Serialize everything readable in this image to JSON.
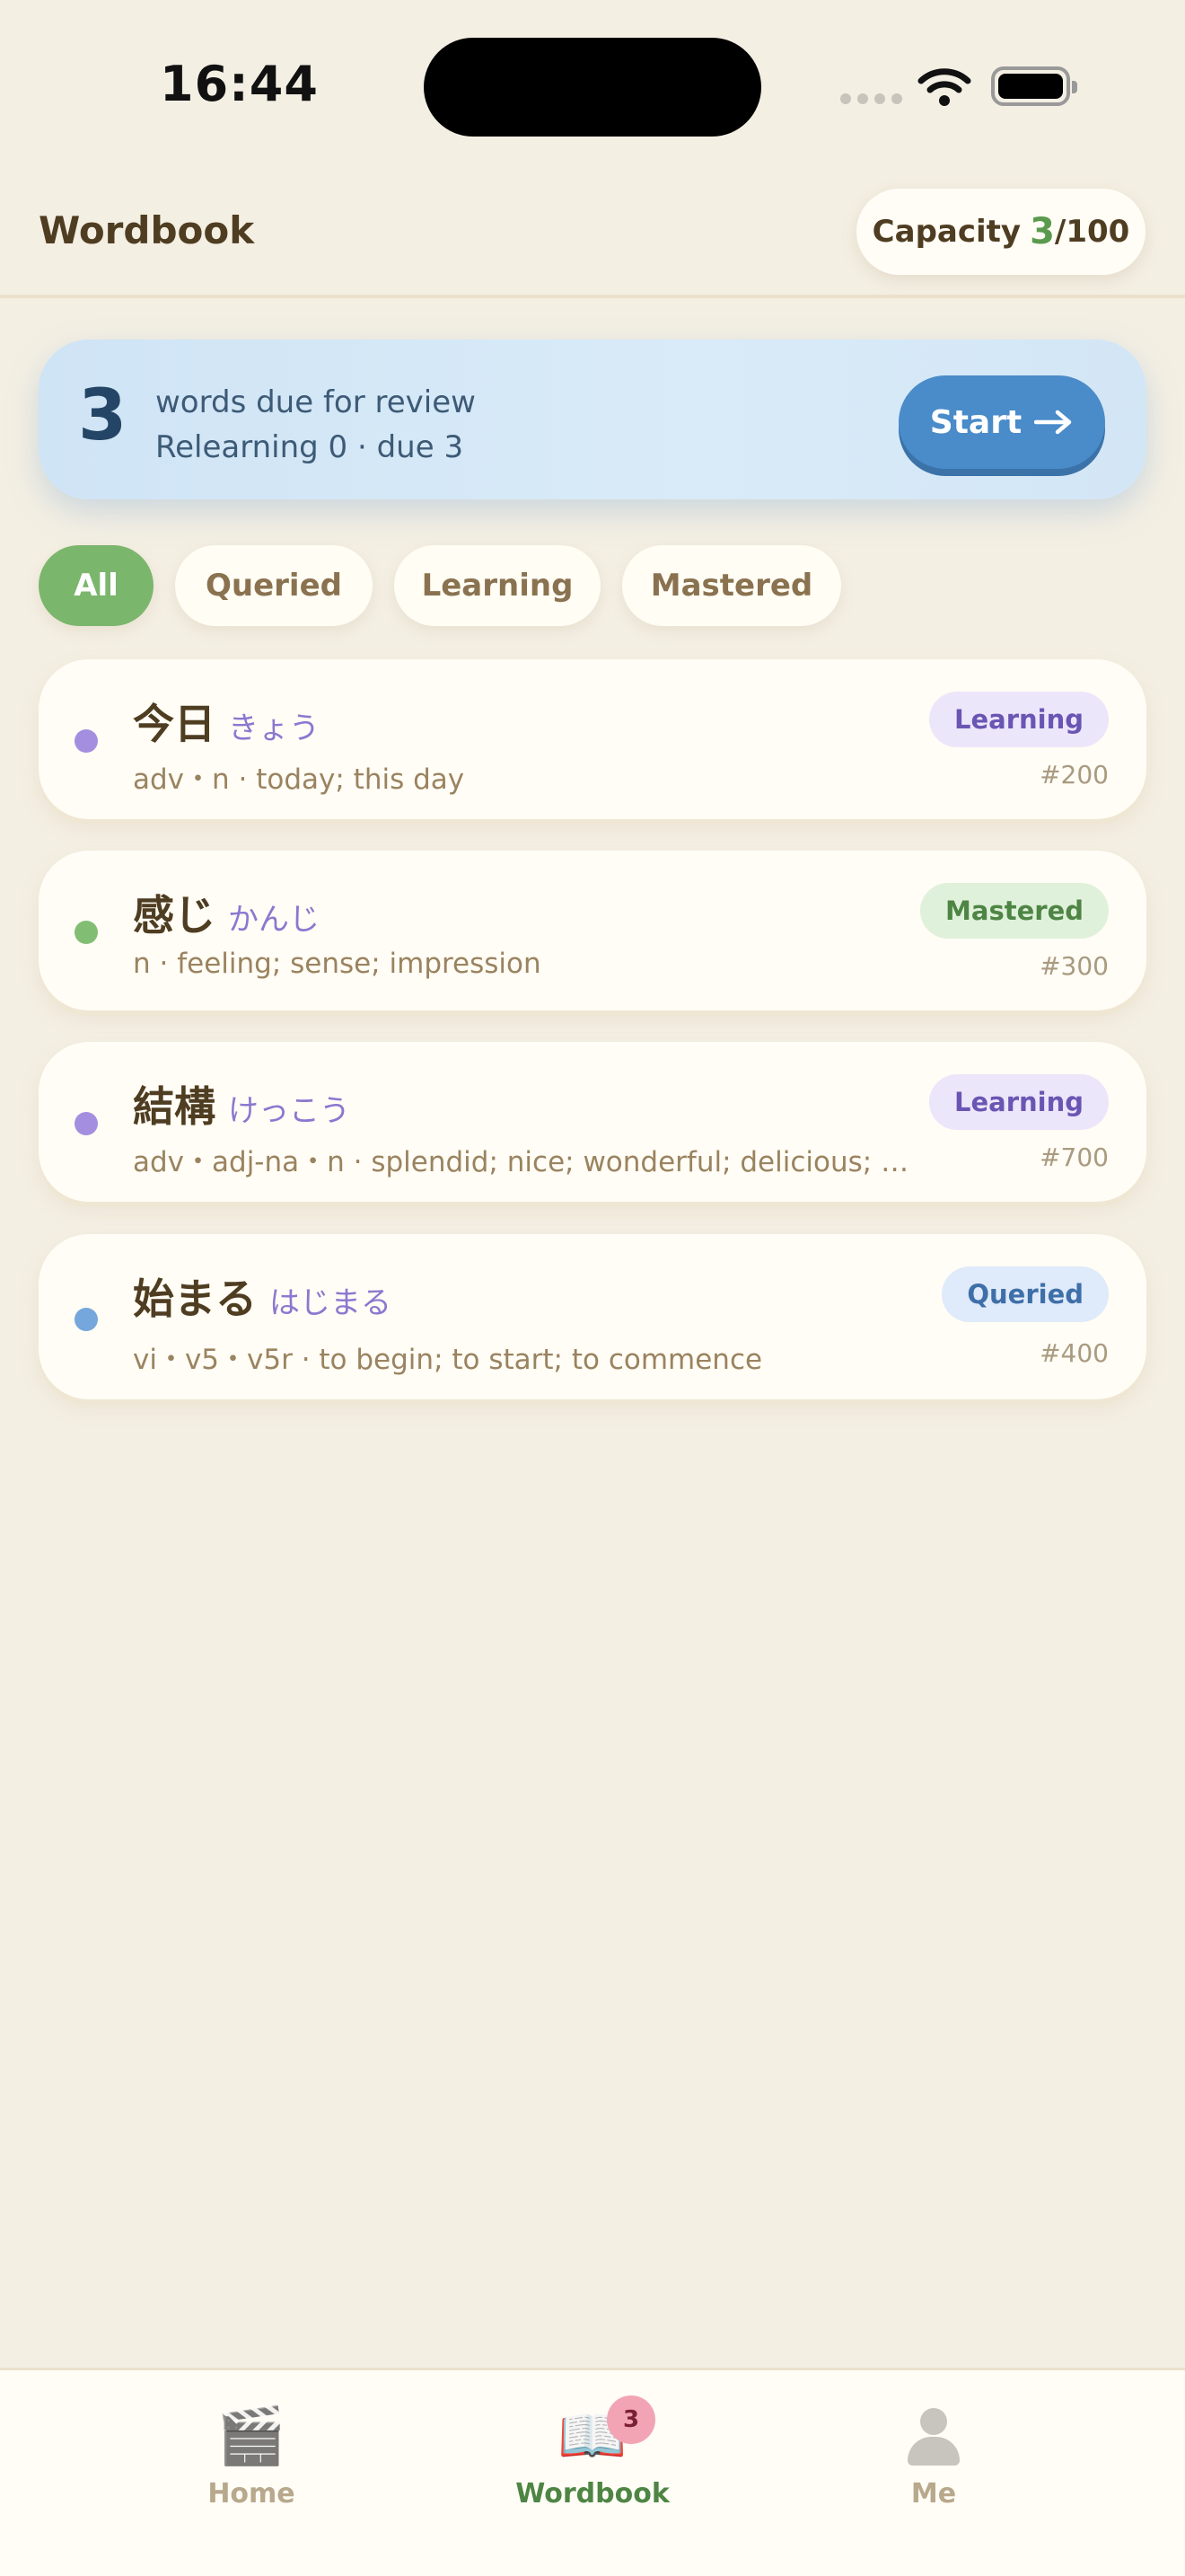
{
  "status_bar": {
    "time": "16:44"
  },
  "header": {
    "title": "Wordbook",
    "capacity_label": "Capacity",
    "capacity_used": "3",
    "capacity_total": "/100"
  },
  "review": {
    "count": "3",
    "line1": "words due for review",
    "line2": "Relearning 0 · due 3",
    "start_label": "Start",
    "start_icon": "arrow-right-icon"
  },
  "filters": [
    "All",
    "Queried",
    "Learning",
    "Mastered"
  ],
  "active_filter": "All",
  "words": [
    {
      "word": "今日",
      "reading": "きょう",
      "gloss": "adv・n · today; this day",
      "status": "Learning",
      "number": "#200",
      "dot_color": "#a48ee0"
    },
    {
      "word": "感じ",
      "reading": "かんじ",
      "gloss": "n · feeling; sense; impression",
      "status": "Mastered",
      "number": "#300",
      "dot_color": "#82bd74"
    },
    {
      "word": "結構",
      "reading": "けっこう",
      "gloss": "adv・adj-na・n · splendid; nice; wonderful; delicious; sw...",
      "status": "Learning",
      "number": "#700",
      "dot_color": "#a48ee0"
    },
    {
      "word": "始まる",
      "reading": "はじまる",
      "gloss": "vi・v5・v5r · to begin; to start; to commence",
      "status": "Queried",
      "number": "#400",
      "dot_color": "#75a6dc"
    }
  ],
  "tab_bar": {
    "tabs": [
      {
        "label": "Home",
        "icon": "clapper-icon"
      },
      {
        "label": "Wordbook",
        "icon": "book-icon",
        "badge": "3"
      },
      {
        "label": "Me",
        "icon": "person-icon"
      }
    ],
    "active": "Wordbook"
  },
  "colors": {
    "background": "#f4efe3",
    "accent_green": "#7bb66d",
    "accent_blue": "#4a8bc9"
  }
}
